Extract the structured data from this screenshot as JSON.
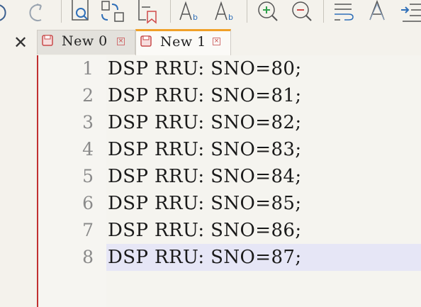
{
  "toolbar": {
    "buttons": [
      {
        "icon": "undo-icon"
      },
      {
        "icon": "redo-icon"
      },
      {
        "icon": "find-icon"
      },
      {
        "icon": "replace-icon"
      },
      {
        "icon": "bookmark-icon"
      },
      {
        "icon": "text-case-icon"
      },
      {
        "icon": "text-style-icon"
      },
      {
        "icon": "zoom-in-icon"
      },
      {
        "icon": "zoom-out-icon"
      },
      {
        "icon": "word-wrap-icon"
      },
      {
        "icon": "font-icon"
      },
      {
        "icon": "indent-icon"
      }
    ]
  },
  "tabs": {
    "close_all": "✕",
    "items": [
      {
        "label": "New 0",
        "active": false
      },
      {
        "label": "New 1",
        "active": true
      }
    ],
    "close_glyph": "×"
  },
  "editor": {
    "current_line": 8,
    "lines": [
      {
        "number": "1",
        "text": "DSP RRU: SNO=80;"
      },
      {
        "number": "2",
        "text": "DSP RRU: SNO=81;"
      },
      {
        "number": "3",
        "text": "DSP RRU: SNO=82;"
      },
      {
        "number": "4",
        "text": "DSP RRU: SNO=83;"
      },
      {
        "number": "5",
        "text": "DSP RRU: SNO=84;"
      },
      {
        "number": "6",
        "text": "DSP RRU: SNO=85;"
      },
      {
        "number": "7",
        "text": "DSP RRU: SNO=86;"
      },
      {
        "number": "8",
        "text": "DSP RRU: SNO=87;"
      }
    ]
  },
  "colors": {
    "background": "#f4f2ec",
    "current_line": "#e6e6f6",
    "active_tab_accent": "#f0a028",
    "margin_line": "#c03030",
    "icon_blue": "#2f6fb8",
    "icon_red": "#d04a4a"
  }
}
